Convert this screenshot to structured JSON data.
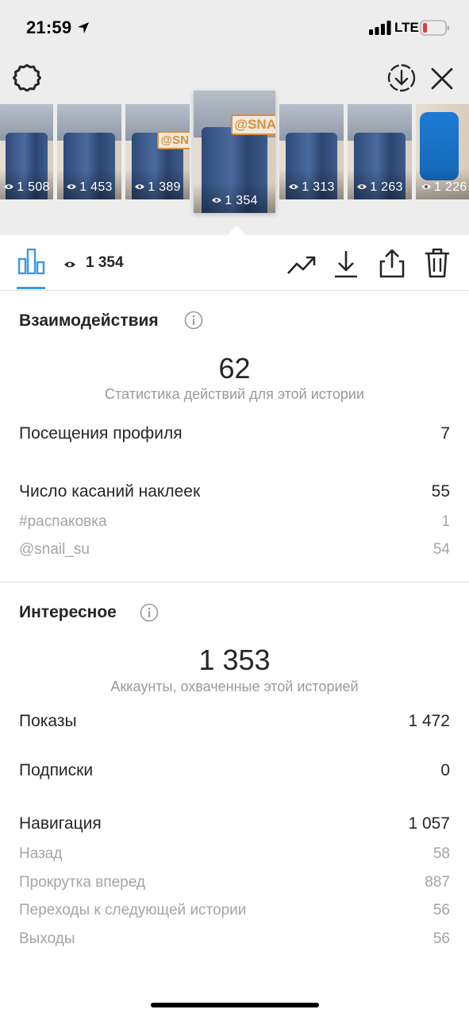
{
  "status_bar": {
    "time": "21:59",
    "network": "LTE"
  },
  "story_thumbnails": [
    {
      "views": "1 508",
      "sticker": ""
    },
    {
      "views": "1 453",
      "sticker": ""
    },
    {
      "views": "1 389",
      "sticker": "@SN"
    },
    {
      "views": "1 354",
      "sticker": "@SNA"
    },
    {
      "views": "1 313",
      "sticker": ""
    },
    {
      "views": "1 263",
      "sticker": ""
    },
    {
      "views": "1 226",
      "sticker": ""
    }
  ],
  "tabbar": {
    "views_count": "1 354"
  },
  "interactions": {
    "title": "Взаимодействия",
    "total": "62",
    "total_caption": "Статистика действий для этой истории",
    "profile_visits_label": "Посещения профиля",
    "profile_visits_value": "7",
    "sticker_taps_label": "Число касаний наклеек",
    "sticker_taps_value": "55",
    "stickers": [
      {
        "label": "#распаковка",
        "value": "1"
      },
      {
        "label": "@snail_su",
        "value": "54"
      }
    ]
  },
  "discovery": {
    "title": "Интересное",
    "reach": "1 353",
    "reach_caption": "Аккаунты, охваченные этой историей",
    "impressions_label": "Показы",
    "impressions_value": "1 472",
    "follows_label": "Подписки",
    "follows_value": "0",
    "navigation_label": "Навигация",
    "navigation_value": "1 057",
    "navigation_items": [
      {
        "label": "Назад",
        "value": "58"
      },
      {
        "label": "Прокрутка вперед",
        "value": "887"
      },
      {
        "label": "Переходы к следующей истории",
        "value": "56"
      },
      {
        "label": "Выходы",
        "value": "56"
      }
    ]
  },
  "colors": {
    "accent": "#3897f0",
    "muted": "#a5a5a5",
    "sticker": "#d98f3c"
  }
}
